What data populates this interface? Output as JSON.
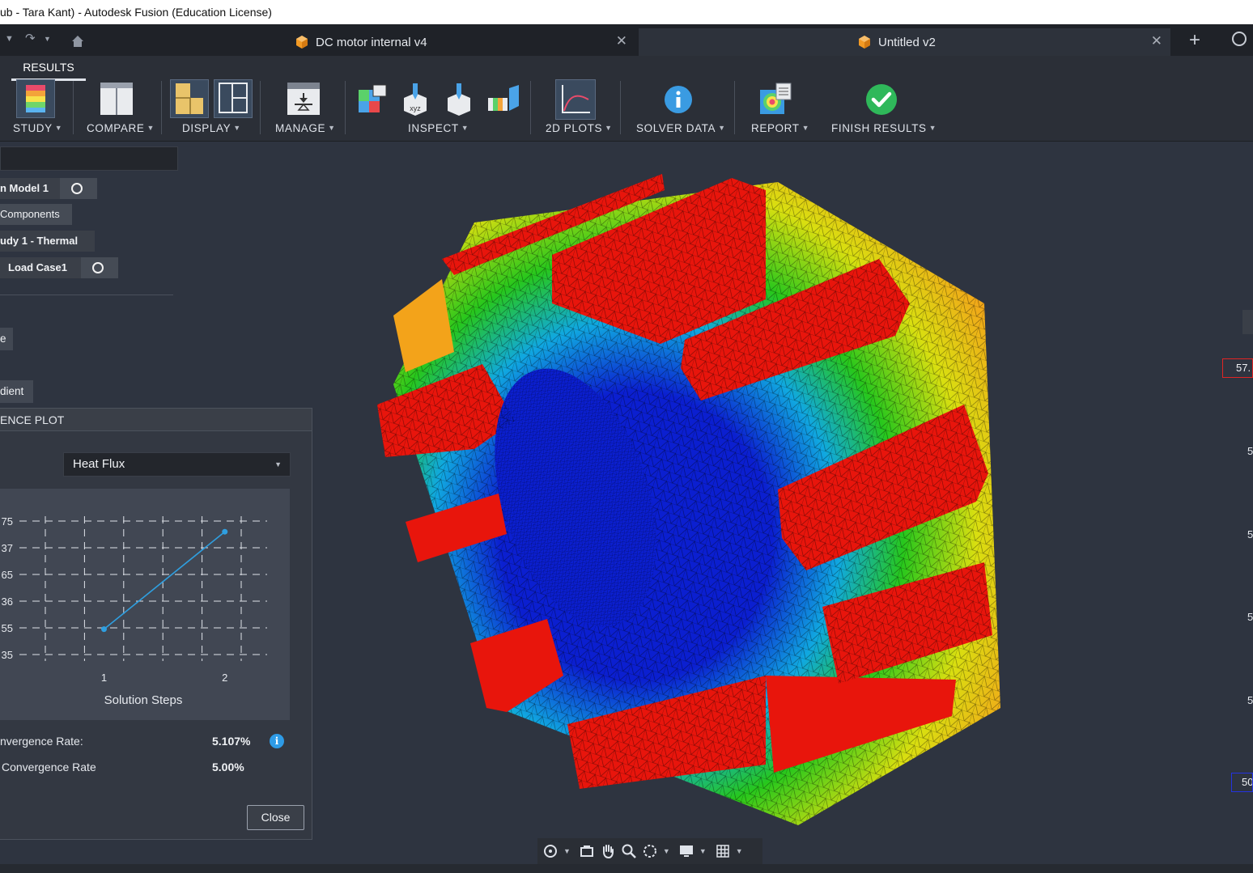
{
  "window": {
    "title": "ub - Tara Kant) - Autodesk Fusion (Education License)"
  },
  "tabs": [
    {
      "label": "DC motor internal v4",
      "close": "✕"
    },
    {
      "label": "Untitled v2",
      "close": "✕"
    }
  ],
  "tabbar": {
    "new_tab": "+"
  },
  "ribbon": {
    "active_tab": "RESULTS",
    "groups": {
      "study": "STUDY",
      "compare": "COMPARE",
      "display": "DISPLAY",
      "manage": "MANAGE",
      "inspect": "INSPECT",
      "plots": "2D PLOTS",
      "solver": "SOLVER DATA",
      "report": "REPORT",
      "finish": "FINISH RESULTS"
    },
    "caret": "▼",
    "inspect_xyz": "xyz"
  },
  "browser": {
    "nodes": [
      {
        "label": "n Model 1"
      },
      {
        "label": "Components"
      },
      {
        "label": "udy 1 - Thermal"
      },
      {
        "label": "Load Case1"
      }
    ],
    "chips": {
      "first": "e",
      "second": "dient"
    }
  },
  "dialog": {
    "title": "ENCE PLOT",
    "result_type": "Heat Flux",
    "select_arrow": "▼",
    "stats": {
      "rate_label": "nvergence Rate:",
      "rate_value": "5.107%",
      "target_label": "Convergence Rate",
      "target_value": "5.00%"
    },
    "info": "i",
    "close_label": "Close"
  },
  "chart_data": {
    "type": "line",
    "title": "",
    "xlabel": "Solution Steps",
    "ylabel": "",
    "x": [
      1,
      2
    ],
    "x_tick_labels": [
      "1",
      "2"
    ],
    "y_tick_labels": [
      "75",
      "37",
      "65",
      "36",
      "55",
      "35"
    ],
    "series": [
      {
        "values": [
          0.95,
          4.6
        ]
      }
    ],
    "ylim": [
      0,
      5
    ],
    "grid": true,
    "line_color": "#2f9fe0"
  },
  "legend": {
    "max_label": "57.",
    "min_label": "50",
    "ticks": [
      "5",
      "5",
      "5",
      "5"
    ],
    "max_color": "#e02424",
    "min_color": "#2433e0"
  },
  "viewport": {
    "model": "motor-stator-mesh",
    "colors": {
      "hot": "#e8150c",
      "warm": "#f3a31a",
      "mid": "#d9df10",
      "cool": "#27c71c",
      "cold": "#10d6d2",
      "coldest": "#0b1fd0"
    }
  }
}
